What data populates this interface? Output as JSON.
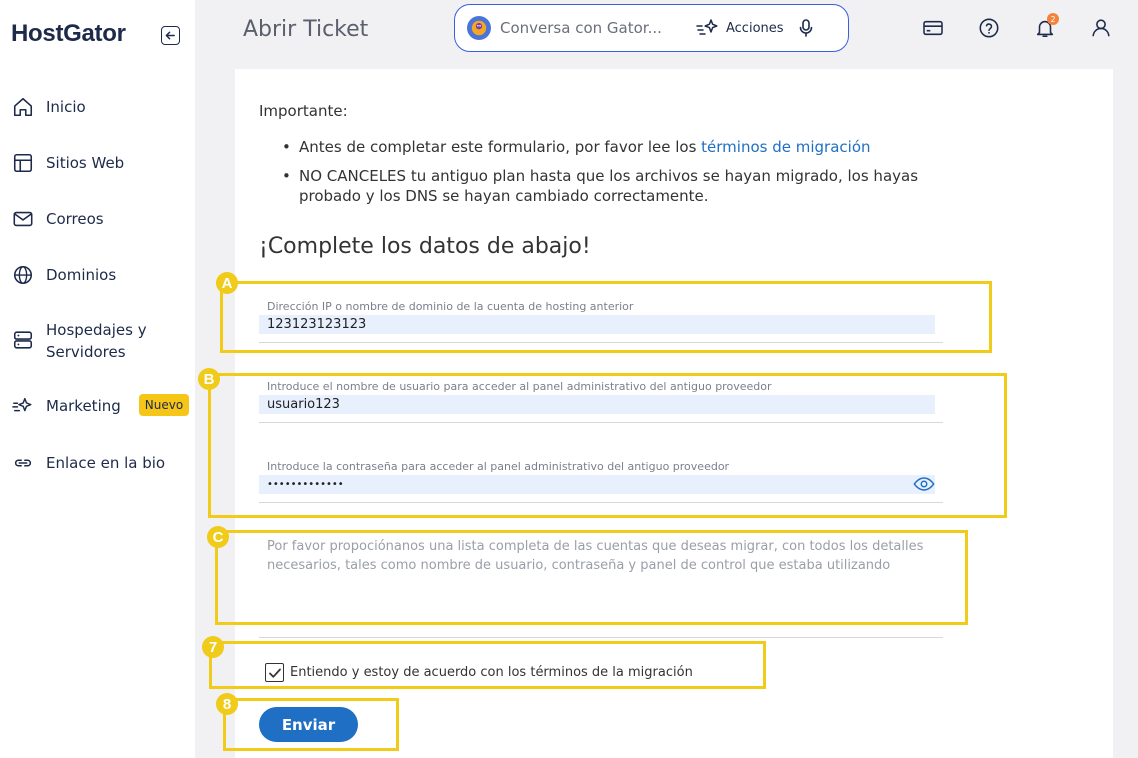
{
  "sidebar": {
    "logo": "HostGator",
    "items": [
      {
        "label": "Inicio"
      },
      {
        "label": "Sitios Web"
      },
      {
        "label": "Correos"
      },
      {
        "label": "Dominios"
      },
      {
        "label": "Hospedajes y Servidores"
      },
      {
        "label": "Marketing",
        "badge": "Nuevo"
      },
      {
        "label": "Enlace en la bio"
      }
    ]
  },
  "header": {
    "title": "Abrir Ticket",
    "chat_placeholder": "Conversa con Gator...",
    "actions_label": "Acciones",
    "notifications_count": "2"
  },
  "main": {
    "important_title": "Importante:",
    "bullet1_text": "Antes de completar este formulario, por favor lee los ",
    "bullet1_link": "términos de migración",
    "bullet2_text": "NO CANCELES tu antiguo plan hasta que los archivos se hayan migrado, los hayas probado y los DNS se hayan cambiado correctamente.",
    "section_title": "¡Complete los datos de abajo!",
    "fields": {
      "ip": {
        "label": "Dirección IP o nombre de dominio de la cuenta de hosting anterior",
        "value": "123123123123"
      },
      "username": {
        "label": "Introduce el nombre de usuario para acceder al panel administrativo del antiguo proveedor",
        "value": "usuario123"
      },
      "password": {
        "label": "Introduce la contraseña para acceder al panel administrativo del antiguo proveedor",
        "value": "•••••••••••••"
      }
    },
    "accounts_placeholder": "Por favor propociónanos una lista completa de las cuentas que deseas migrar, con todos los detalles necesarios, tales como nombre de usuario, contraseña y panel de control que estaba utilizando",
    "agree_label": "Entiendo y estoy de acuerdo con los términos de la migración",
    "submit_label": "Enviar"
  },
  "annotations": {
    "a": "A",
    "b": "B",
    "c": "C",
    "seven": "7",
    "eight": "8"
  },
  "colors": {
    "accent": "#1f6fc5",
    "annotation": "#f0cb1a",
    "badge": "#f5c518"
  }
}
